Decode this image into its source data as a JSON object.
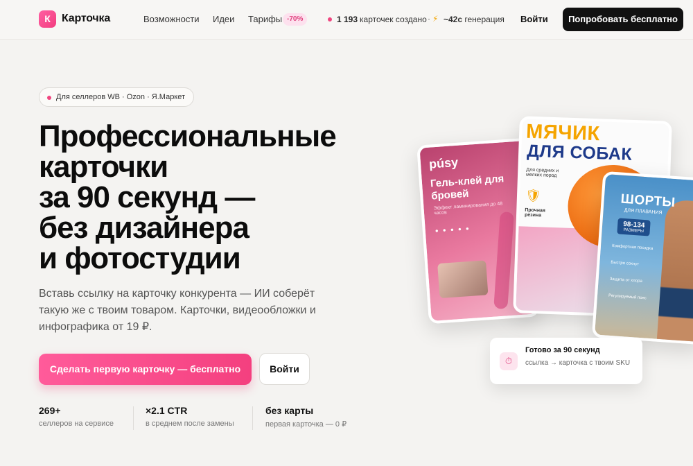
{
  "nav": {
    "logo_letter": "К",
    "brand": "Карточка",
    "links": [
      "Возможности",
      "Идеи",
      "Тарифы"
    ],
    "promo_badge": "-70%",
    "stats_count": "1 193",
    "stats_text": "карточек создано",
    "separator": "·",
    "bolt_icon": "⚡",
    "gen_value": "~42с",
    "gen_text": "генерация",
    "login": "Войти",
    "try_button": "Попробовать бесплатно"
  },
  "hero": {
    "pill": "Для селлеров WB · Ozon · Я.Маркет",
    "headline": [
      "Профессиональные",
      "карточки",
      "за 90 секунд —",
      "без дизайнера",
      "и фотостудии"
    ],
    "subtitle": "Вставь ссылку на карточку конкурента — ИИ соберёт такую же с твоим товаром. Карточки, видеообложки и инфографика от 19 ₽.",
    "cta": "Сделать первую карточку — бесплатно",
    "login": "Войти",
    "metrics": [
      {
        "value": "269+",
        "label": "селлеров на сервисе"
      },
      {
        "value": "×2.1 CTR",
        "label": "в среднем после замены"
      },
      {
        "value": "без карты",
        "label": "первая карточка — 0 ₽"
      }
    ]
  },
  "cards": {
    "card1": {
      "brand": "púsy",
      "title": "Гель-клей для бровей",
      "sub": "Эффект ламинирования до 48 часов",
      "dots": "● ● ● ● ●"
    },
    "card2": {
      "title1": "МЯЧИК",
      "title2": "ДЛЯ СОБАК",
      "sub": "Для средних и мелких пород",
      "strong": "Прочная резина",
      "shield_icon": "🛡"
    },
    "card3": {
      "title": "ШОРТЫ",
      "sub": "ДЛЯ ПЛАВАНИЯ",
      "size": "98-134",
      "size_label": "РАЗМЕРЫ",
      "features": [
        "Комфортная посадка",
        "Быстро сохнут",
        "Защита от хлора",
        "Регулируемый пояс"
      ]
    }
  },
  "toast": {
    "icon": "⏱",
    "title": "Готово за 90 секунд",
    "text": "ссылка → карточка с твоим SKU"
  },
  "colors": {
    "accent": "#f0457f",
    "dark": "#111111",
    "background": "#f4f3f1"
  }
}
